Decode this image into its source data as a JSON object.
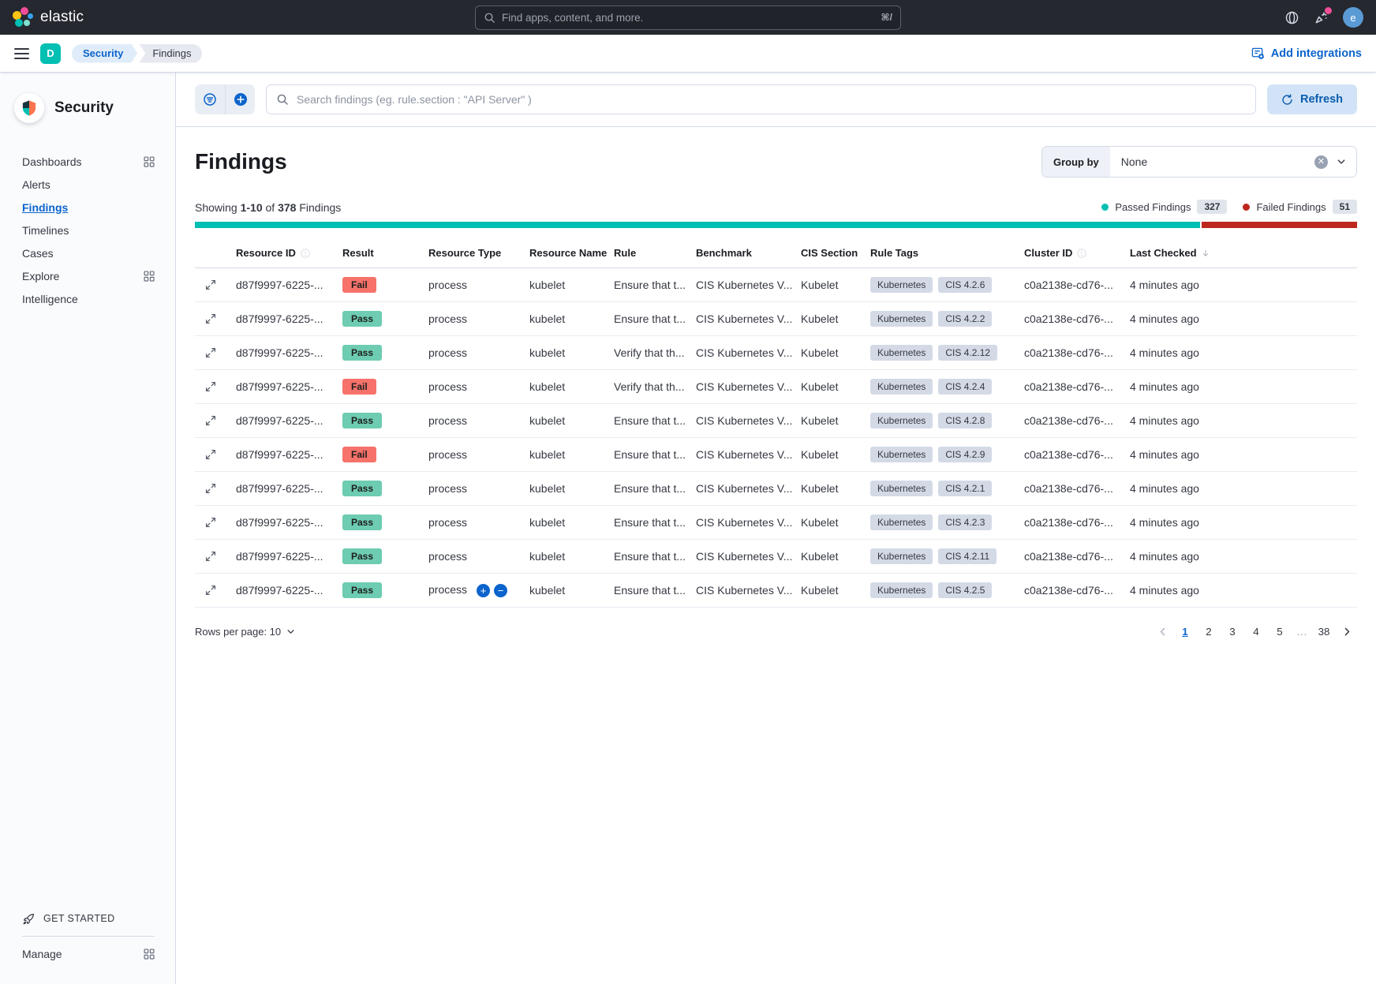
{
  "colors": {
    "header_bg": "#25282F",
    "brand_teal": "#00BFB3",
    "danger_red": "#BD271E",
    "primary_blue": "#0B64CC",
    "fail_badge_bg": "#F6726A",
    "pass_badge_bg": "#6DCCB1",
    "tag_badge_bg": "#D3DAE6",
    "count_badge_bg": "#E0E4EB",
    "refresh_btn_bg": "#D2E3F7",
    "refresh_btn_text": "#0B5CAD",
    "space_badge_bg": "#00BFB3",
    "avatar_bg": "#5A9BD6",
    "notification_pink": "#F04E98",
    "text_dark": "#343741",
    "text_heading": "#1A1C21",
    "border": "#D3DAE6",
    "row_border": "#E8ECF2",
    "sidebar_bg": "#FAFBFD",
    "security_pill_bg": "#E0ECF9",
    "findings_pill_bg": "#E6E9EF"
  },
  "header": {
    "brand": "elastic",
    "search": {
      "placeholder": "Find apps, content, and more.",
      "shortcut": "⌘/"
    },
    "avatar_letter": "e"
  },
  "navbar": {
    "space_badge": "D",
    "breadcrumbs": [
      "Security",
      "Findings"
    ],
    "add_integrations": "Add integrations"
  },
  "sidebar": {
    "title": "Security",
    "items": [
      {
        "label": "Dashboards",
        "grid": true
      },
      {
        "label": "Alerts"
      },
      {
        "label": "Findings",
        "active": true
      },
      {
        "label": "Timelines"
      },
      {
        "label": "Cases"
      },
      {
        "label": "Explore",
        "grid": true
      },
      {
        "label": "Intelligence"
      }
    ],
    "get_started": "GET STARTED",
    "manage_label": "Manage"
  },
  "toolbar": {
    "search_placeholder": "Search findings (eg. rule.section : \"API Server\" )",
    "refresh_label": "Refresh"
  },
  "findings": {
    "title": "Findings",
    "group_by_label": "Group by",
    "group_by_value": "None",
    "showing": {
      "prefix": "Showing",
      "range": "1-10",
      "of": "of",
      "total": "378",
      "suffix": "Findings"
    },
    "legend": {
      "passed_label": "Passed Findings",
      "passed_count": "327",
      "failed_label": "Failed Findings",
      "failed_count": "51"
    }
  },
  "table": {
    "columns": [
      {
        "label": ""
      },
      {
        "label": "Resource ID",
        "hint": true
      },
      {
        "label": "Result"
      },
      {
        "label": "Resource Type"
      },
      {
        "label": "Resource Name"
      },
      {
        "label": "Rule"
      },
      {
        "label": "Benchmark"
      },
      {
        "label": "CIS Section"
      },
      {
        "label": "Rule Tags"
      },
      {
        "label": "Cluster ID",
        "hint": true
      },
      {
        "label": "Last Checked",
        "sort": "down"
      }
    ],
    "rows": [
      {
        "resource_id": "d87f9997-6225-...",
        "result": "Fail",
        "resource_type": "process",
        "resource_name": "kubelet",
        "rule": "Ensure that t...",
        "benchmark": "CIS Kubernetes V...",
        "cis_section": "Kubelet",
        "tags": [
          "Kubernetes",
          "CIS 4.2.6"
        ],
        "cluster_id": "c0a2138e-cd76-...",
        "last_checked": "4 minutes ago"
      },
      {
        "resource_id": "d87f9997-6225-...",
        "result": "Pass",
        "resource_type": "process",
        "resource_name": "kubelet",
        "rule": "Ensure that t...",
        "benchmark": "CIS Kubernetes V...",
        "cis_section": "Kubelet",
        "tags": [
          "Kubernetes",
          "CIS 4.2.2"
        ],
        "cluster_id": "c0a2138e-cd76-...",
        "last_checked": "4 minutes ago"
      },
      {
        "resource_id": "d87f9997-6225-...",
        "result": "Pass",
        "resource_type": "process",
        "resource_name": "kubelet",
        "rule": "Verify that th...",
        "benchmark": "CIS Kubernetes V...",
        "cis_section": "Kubelet",
        "tags": [
          "Kubernetes",
          "CIS 4.2.12"
        ],
        "cluster_id": "c0a2138e-cd76-...",
        "last_checked": "4 minutes ago"
      },
      {
        "resource_id": "d87f9997-6225-...",
        "result": "Fail",
        "resource_type": "process",
        "resource_name": "kubelet",
        "rule": "Verify that th...",
        "benchmark": "CIS Kubernetes V...",
        "cis_section": "Kubelet",
        "tags": [
          "Kubernetes",
          "CIS 4.2.4"
        ],
        "cluster_id": "c0a2138e-cd76-...",
        "last_checked": "4 minutes ago"
      },
      {
        "resource_id": "d87f9997-6225-...",
        "result": "Pass",
        "resource_type": "process",
        "resource_name": "kubelet",
        "rule": "Ensure that t...",
        "benchmark": "CIS Kubernetes V...",
        "cis_section": "Kubelet",
        "tags": [
          "Kubernetes",
          "CIS 4.2.8"
        ],
        "cluster_id": "c0a2138e-cd76-...",
        "last_checked": "4 minutes ago"
      },
      {
        "resource_id": "d87f9997-6225-...",
        "result": "Fail",
        "resource_type": "process",
        "resource_name": "kubelet",
        "rule": "Ensure that t...",
        "benchmark": "CIS Kubernetes V...",
        "cis_section": "Kubelet",
        "tags": [
          "Kubernetes",
          "CIS 4.2.9"
        ],
        "cluster_id": "c0a2138e-cd76-...",
        "last_checked": "4 minutes ago"
      },
      {
        "resource_id": "d87f9997-6225-...",
        "result": "Pass",
        "resource_type": "process",
        "resource_name": "kubelet",
        "rule": "Ensure that t...",
        "benchmark": "CIS Kubernetes V...",
        "cis_section": "Kubelet",
        "tags": [
          "Kubernetes",
          "CIS 4.2.1"
        ],
        "cluster_id": "c0a2138e-cd76-...",
        "last_checked": "4 minutes ago"
      },
      {
        "resource_id": "d87f9997-6225-...",
        "result": "Pass",
        "resource_type": "process",
        "resource_name": "kubelet",
        "rule": "Ensure that t...",
        "benchmark": "CIS Kubernetes V...",
        "cis_section": "Kubelet",
        "tags": [
          "Kubernetes",
          "CIS 4.2.3"
        ],
        "cluster_id": "c0a2138e-cd76-...",
        "last_checked": "4 minutes ago"
      },
      {
        "resource_id": "d87f9997-6225-...",
        "result": "Pass",
        "resource_type": "process",
        "resource_name": "kubelet",
        "rule": "Ensure that t...",
        "benchmark": "CIS Kubernetes V...",
        "cis_section": "Kubelet",
        "tags": [
          "Kubernetes",
          "CIS 4.2.11"
        ],
        "cluster_id": "c0a2138e-cd76-...",
        "last_checked": "4 minutes ago"
      },
      {
        "resource_id": "d87f9997-6225-...",
        "result": "Pass",
        "resource_type": "process",
        "resource_name": "kubelet",
        "rule": "Ensure that t...",
        "benchmark": "CIS Kubernetes V...",
        "cis_section": "Kubelet",
        "tags": [
          "Kubernetes",
          "CIS 4.2.5"
        ],
        "cluster_id": "c0a2138e-cd76-...",
        "last_checked": "4 minutes ago",
        "filter_actions": true
      }
    ]
  },
  "pagination": {
    "rows_per_page_label": "Rows per page: 10",
    "pages": [
      {
        "label": "1",
        "active": true
      },
      {
        "label": "2"
      },
      {
        "label": "3"
      },
      {
        "label": "4"
      },
      {
        "label": "5"
      },
      {
        "label": "…",
        "ellipsis": true
      },
      {
        "label": "38"
      }
    ]
  }
}
